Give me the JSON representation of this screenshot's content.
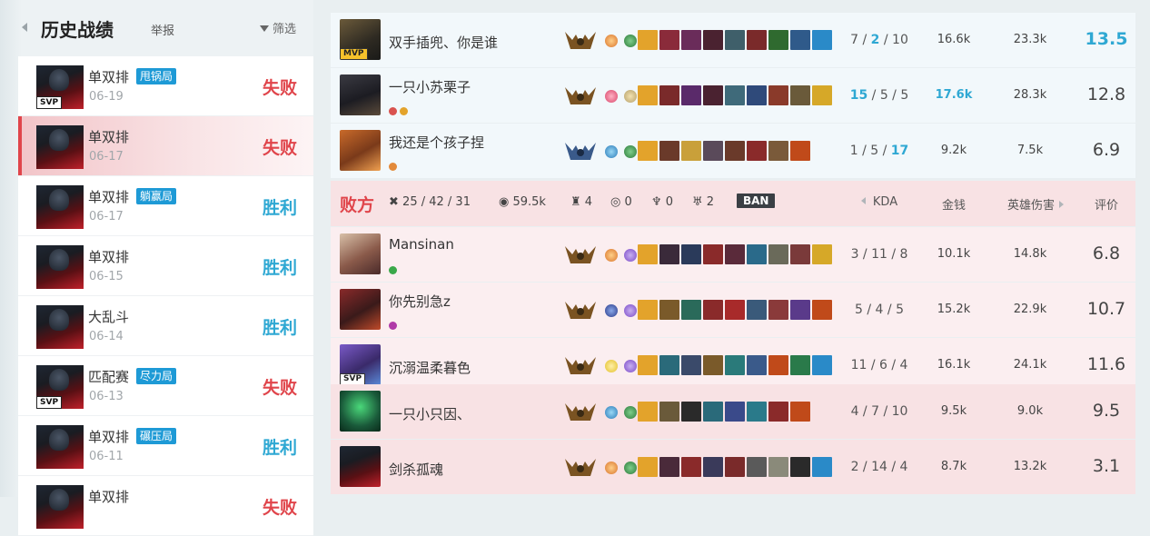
{
  "header": {
    "title": "历史战绩",
    "report": "举报",
    "filter": "筛选"
  },
  "matches": [
    {
      "mode": "单双排",
      "tag": "甩锅局",
      "date": "06-19",
      "result": "失败",
      "badge": "SVP"
    },
    {
      "mode": "单双排",
      "tag": "",
      "date": "06-17",
      "result": "失败",
      "badge": ""
    },
    {
      "mode": "单双排",
      "tag": "躺赢局",
      "date": "06-17",
      "result": "胜利",
      "badge": ""
    },
    {
      "mode": "单双排",
      "tag": "",
      "date": "06-15",
      "result": "胜利",
      "badge": ""
    },
    {
      "mode": "大乱斗",
      "tag": "",
      "date": "06-14",
      "result": "胜利",
      "badge": ""
    },
    {
      "mode": "匹配赛",
      "tag": "尽力局",
      "date": "06-13",
      "result": "失败",
      "badge": "SVP"
    },
    {
      "mode": "单双排",
      "tag": "碾压局",
      "date": "06-11",
      "result": "胜利",
      "badge": ""
    },
    {
      "mode": "单双排",
      "tag": "",
      "date": "",
      "result": "失败",
      "badge": ""
    }
  ],
  "win_team": [
    {
      "name": "双手插兜、你是谁",
      "badge": "MVP",
      "k": "7",
      "d": "2",
      "a": "10",
      "gold": "16.6k",
      "damage": "23.3k",
      "score": "13.5"
    },
    {
      "name": "一只小苏栗子",
      "badge": "",
      "k": "15",
      "d": "5",
      "a": "5",
      "gold": "17.6k",
      "damage": "28.3k",
      "score": "12.8"
    },
    {
      "name": "我还是个孩子捏",
      "badge": "",
      "k": "1",
      "d": "5",
      "a": "17",
      "gold": "9.2k",
      "damage": "7.5k",
      "score": "6.9"
    }
  ],
  "loss_header": {
    "label": "败方",
    "kda": "25 / 42 / 31",
    "gold": "59.5k",
    "towers": "4",
    "inhibitors": "0",
    "barons": "0",
    "dragons": "2",
    "ban": "BAN",
    "col_kda": "KDA",
    "col_gold": "金钱",
    "col_damage": "英雄伤害",
    "col_score": "评价"
  },
  "loss_team": [
    {
      "name": "Mansinan",
      "badge": "",
      "kda": "3 / 11 / 8",
      "gold": "10.1k",
      "damage": "14.8k",
      "score": "6.8"
    },
    {
      "name": "你先别急z",
      "badge": "",
      "kda": "5 / 4 / 5",
      "gold": "15.2k",
      "damage": "22.9k",
      "score": "10.7"
    },
    {
      "name": "沉溺温柔暮色",
      "badge": "SVP",
      "kda": "11 / 6 / 4",
      "gold": "16.1k",
      "damage": "24.1k",
      "score": "11.6"
    },
    {
      "name": "一只小只因、",
      "badge": "",
      "kda": "4 / 7 / 10",
      "gold": "9.5k",
      "damage": "9.0k",
      "score": "9.5"
    },
    {
      "name": "剑杀孤魂",
      "badge": "",
      "kda": "2 / 14 / 4",
      "gold": "8.7k",
      "damage": "13.2k",
      "score": "3.1"
    }
  ],
  "colors": {
    "loss_red": "#e0454b",
    "win_blue": "#2fa8d3",
    "tag_blue": "#1e9ad6"
  }
}
